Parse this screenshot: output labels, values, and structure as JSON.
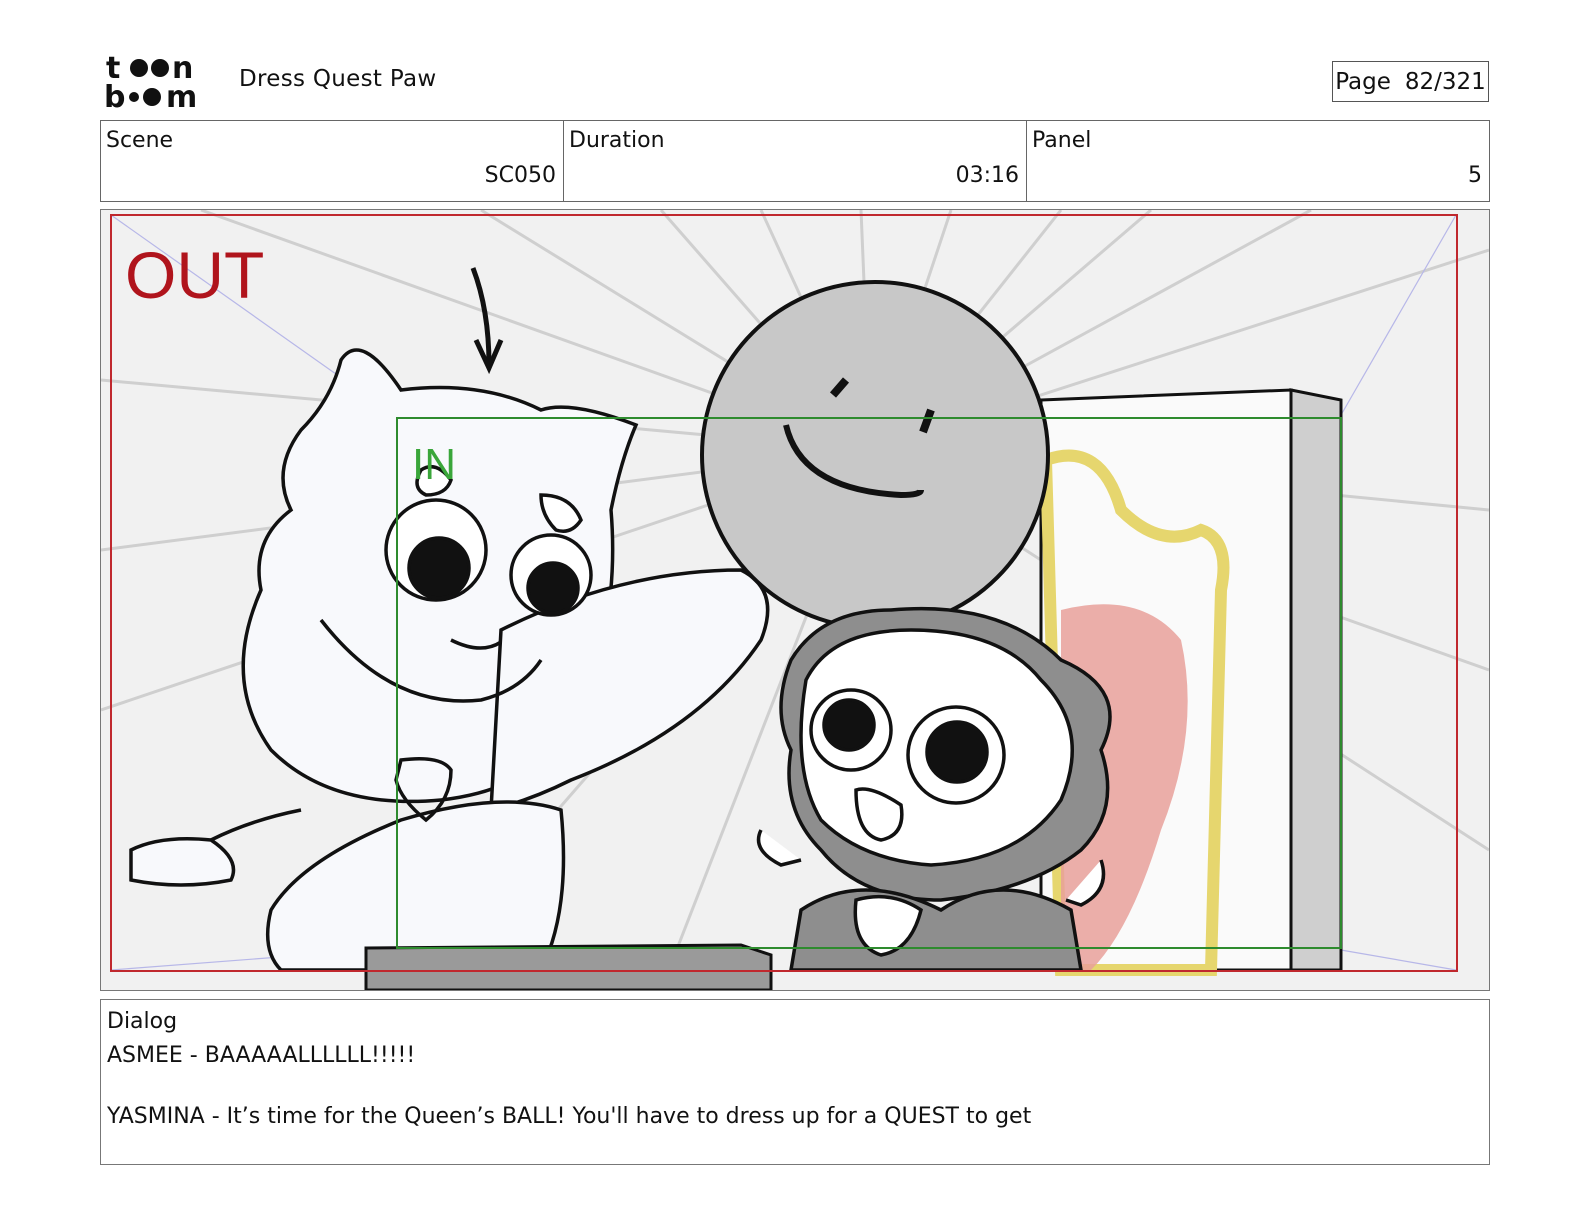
{
  "header": {
    "logo_text": "toon boom",
    "project_title": "Dress Quest Paw",
    "page_label": "Page",
    "page_value": "82/321"
  },
  "info": {
    "scene_label": "Scene",
    "scene_value": "SC050",
    "duration_label": "Duration",
    "duration_value": "03:16",
    "panel_label": "Panel",
    "panel_value": "5"
  },
  "panel": {
    "out_label": "OUT",
    "in_label": "IN",
    "colors": {
      "out_frame": "#c0282e",
      "in_frame": "#2e8b2e",
      "ball": "#c8c8c8",
      "throne_gold": "#e6d66e",
      "throne_red": "#e8a09a"
    }
  },
  "dialog": {
    "label": "Dialog",
    "lines": [
      "ASMEE - BAAAAALLLLLL!!!!!",
      "YASMINA - It’s time for the Queen’s BALL! You'll have to dress up for a QUEST to get"
    ]
  }
}
